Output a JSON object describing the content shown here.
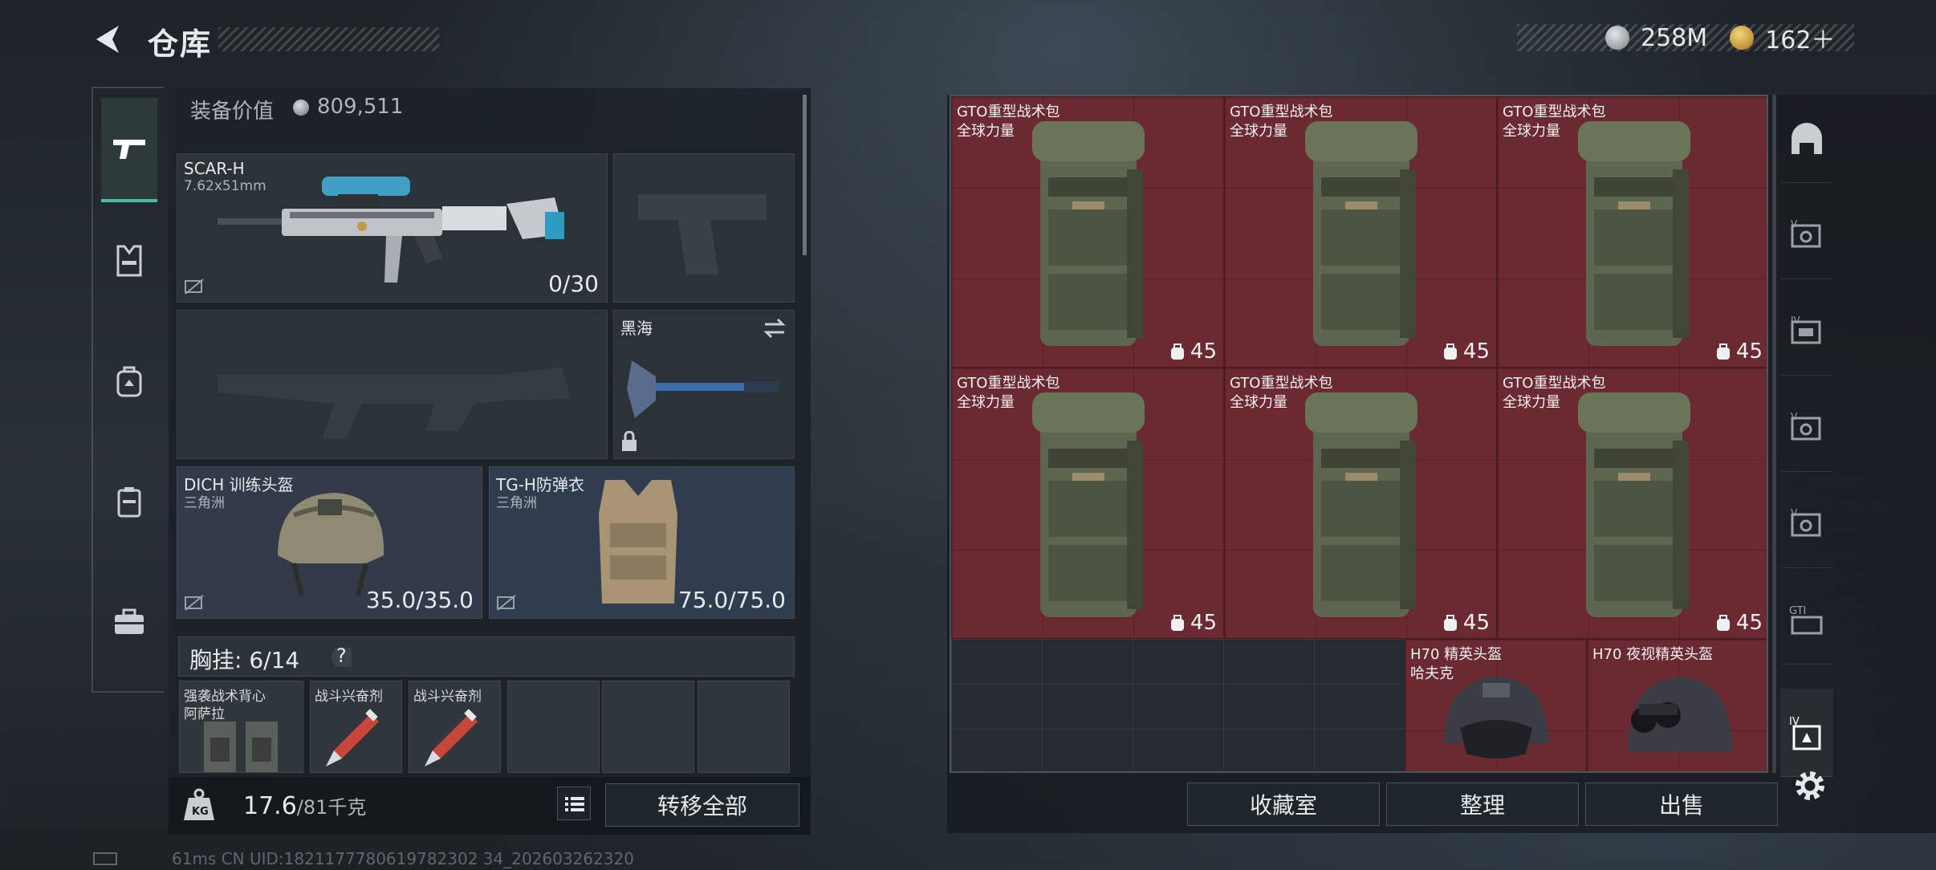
{
  "header": {
    "title": "仓库",
    "currency": [
      {
        "icon": "coin-icon",
        "value": "258M"
      },
      {
        "icon": "gold-coin-icon",
        "value": "162＋"
      }
    ]
  },
  "left_nav": {
    "items": [
      {
        "name": "weapon",
        "icon": "gun-icon"
      },
      {
        "name": "chest-rig",
        "icon": "vest-icon"
      },
      {
        "name": "backpack",
        "icon": "backpack-icon"
      },
      {
        "name": "pouch",
        "icon": "container-icon"
      },
      {
        "name": "case",
        "icon": "briefcase-icon"
      }
    ]
  },
  "equipment": {
    "value_label": "装备价值",
    "value": "809,511",
    "primary_weapon": {
      "name": "SCAR-H",
      "caliber": "7.62x51mm",
      "ammo": "0/30"
    },
    "melee": {
      "name": "黑海"
    },
    "helmet": {
      "name": "DICH 训练头盔",
      "faction": "三角洲",
      "durability": "35.0/35.0"
    },
    "armor": {
      "name": "TG-H防弹衣",
      "faction": "三角洲",
      "durability": "75.0/75.0"
    },
    "chest_rig_label": "胸挂: 6/14",
    "chest_help": "?",
    "rig_items": [
      {
        "name": "强袭战术背心",
        "sub": "阿萨拉"
      },
      {
        "name": "战斗兴奋剂",
        "sub": ""
      },
      {
        "name": "战斗兴奋剂",
        "sub": ""
      }
    ]
  },
  "footer": {
    "weight": "17.6",
    "weight_unit": "/81千克",
    "transfer_all": "转移全部"
  },
  "stash": {
    "items": [
      {
        "name": "GTO重型战术包",
        "sub": "全球力量",
        "value": "45"
      },
      {
        "name": "GTO重型战术包",
        "sub": "全球力量",
        "value": "45"
      },
      {
        "name": "GTO重型战术包",
        "sub": "全球力量",
        "value": "45"
      },
      {
        "name": "GTO重型战术包",
        "sub": "全球力量",
        "value": "45"
      },
      {
        "name": "GTO重型战术包",
        "sub": "全球力量",
        "value": "45"
      },
      {
        "name": "GTO重型战术包",
        "sub": "全球力量",
        "value": "45"
      },
      {
        "name": "H70 精英头盔",
        "sub": "哈夫克",
        "value": ""
      },
      {
        "name": "H70 夜视精英头盔",
        "sub": "",
        "value": ""
      }
    ],
    "buttons": {
      "collection": "收藏室",
      "sort": "整理",
      "sell": "出售"
    }
  },
  "status": {
    "line": "61ms    CN UID:1821177780619782302 34_202603262320"
  },
  "colors": {
    "accent": "#36c9a0",
    "item_red": "#6b2931"
  }
}
